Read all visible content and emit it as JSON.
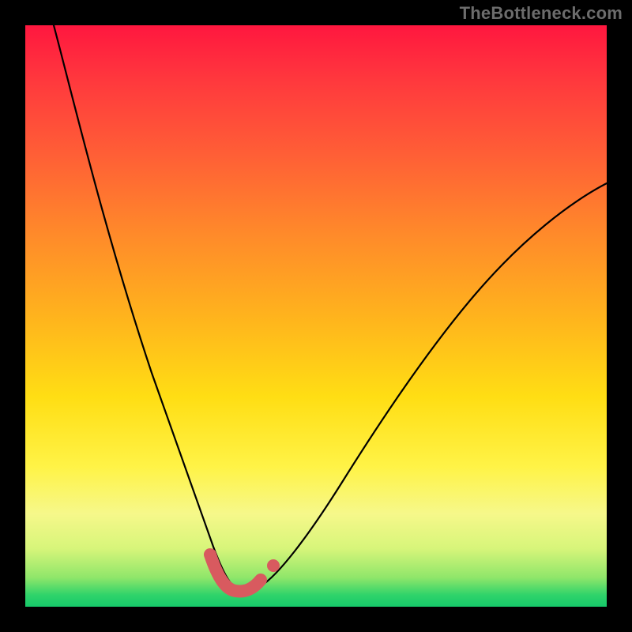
{
  "watermark": "TheBottleneck.com",
  "colors": {
    "background": "#000000",
    "curve": "#000000",
    "highlight": "#d85a5f",
    "gradient_top": "#ff173f",
    "gradient_bottom": "#16c96a"
  },
  "chart_data": {
    "type": "line",
    "title": "",
    "xlabel": "",
    "ylabel": "",
    "xlim": [
      0,
      100
    ],
    "ylim": [
      0,
      100
    ],
    "series": [
      {
        "name": "curve",
        "x": [
          5,
          10,
          15,
          20,
          25,
          28,
          30,
          32,
          34,
          36,
          38,
          40,
          45,
          50,
          55,
          60,
          65,
          70,
          75,
          80,
          85,
          90,
          95,
          100
        ],
        "y": [
          100,
          84,
          66,
          48,
          30,
          20,
          14,
          9,
          5,
          3,
          3,
          4,
          8,
          15,
          23,
          31,
          39,
          46,
          52,
          58,
          63,
          67,
          70,
          73
        ]
      }
    ],
    "annotations": {
      "note": "Highlighted salmon segment marks the trough region of the curve (approx x 32–40, y ≈ 3–5). Isolated highlight dot near x≈41, y≈5."
    }
  }
}
